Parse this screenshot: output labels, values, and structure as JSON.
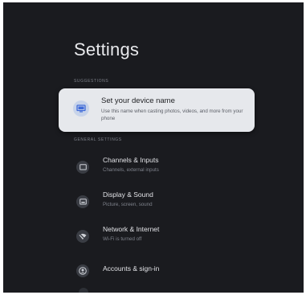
{
  "page": {
    "title": "Settings"
  },
  "suggestions": {
    "header": "SUGGESTIONS",
    "card": {
      "icon": "tv-cast-icon",
      "title": "Set your device name",
      "subtitle": "Use this name when casting photos, videos, and more from your phone"
    }
  },
  "general": {
    "header": "GENERAL SETTINGS",
    "items": [
      {
        "icon": "input-icon",
        "label": "Channels & Inputs",
        "subtitle": "Channels, external inputs"
      },
      {
        "icon": "display-icon",
        "label": "Display & Sound",
        "subtitle": "Picture, screen, sound"
      },
      {
        "icon": "wifi-off-icon",
        "label": "Network & Internet",
        "subtitle": "Wi-Fi is turned off"
      },
      {
        "icon": "account-icon",
        "label": "Accounts & sign-in",
        "subtitle": ""
      }
    ]
  },
  "colors": {
    "background": "#1a1b1f",
    "card": "#e6e8ec",
    "card_icon_bg": "#c7d3ea",
    "accent": "#3f6ad8"
  }
}
